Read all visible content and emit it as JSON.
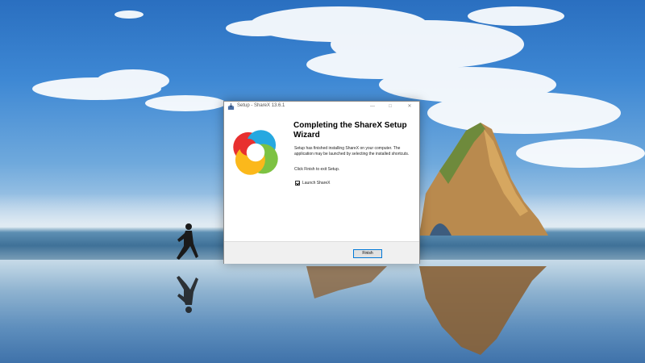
{
  "dialog": {
    "title": "Setup - ShareX 13.6.1",
    "heading": "Completing the ShareX Setup Wizard",
    "body": "Setup has finished installing ShareX on your computer. The application may be launched by selecting the installed shortcuts.",
    "exit_instruction": "Click Finish to exit Setup.",
    "launch_checkbox": {
      "label": "Launch ShareX",
      "checked": true
    },
    "finish_label": "Finish",
    "window_controls": {
      "minimize": "—",
      "maximize": "□",
      "close": "✕"
    }
  },
  "icons": [
    "setup-app-icon",
    "sharex-logo",
    "checkbox-check-icon"
  ],
  "colors": {
    "sky_top": "#2a6fc0",
    "button_border_accent": "#0078d7",
    "footer_bg": "#f0f0f0"
  }
}
